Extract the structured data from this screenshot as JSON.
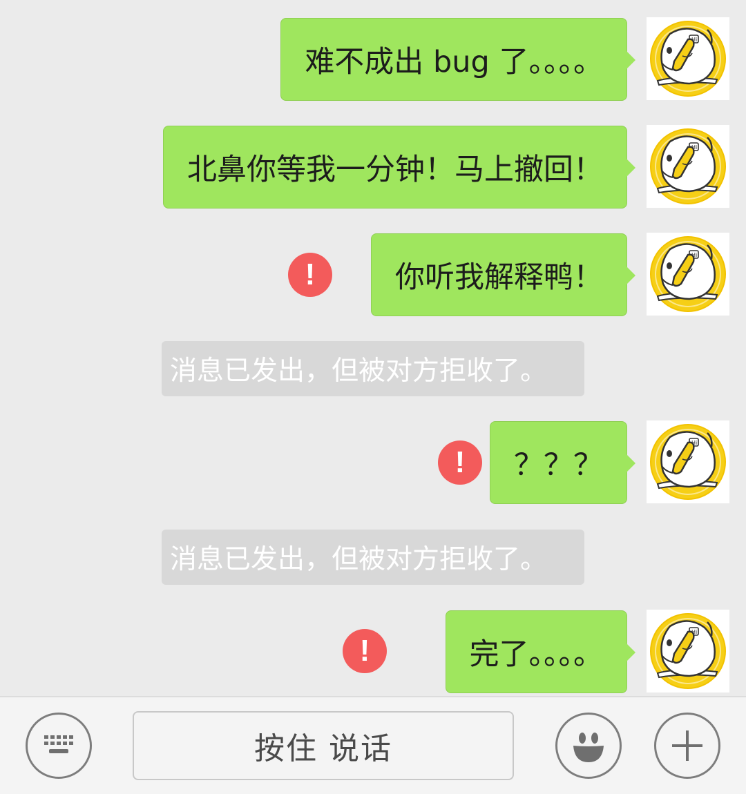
{
  "messages": [
    {
      "type": "sent",
      "text": "难不成出 bug 了。。。。",
      "failed": false
    },
    {
      "type": "sent",
      "text": "北鼻你等我一分钟！马上撤回！",
      "failed": false
    },
    {
      "type": "sent",
      "text": "你听我解释鸭！",
      "failed": true
    },
    {
      "type": "system",
      "text": "消息已发出，但被对方拒收了。"
    },
    {
      "type": "sent",
      "text": "？？？",
      "failed": true
    },
    {
      "type": "system",
      "text": "消息已发出，但被对方拒收了。"
    },
    {
      "type": "sent",
      "text": "完了。。。。",
      "failed": true
    }
  ],
  "error_mark": "!",
  "avatar": {
    "badge": "Hi"
  },
  "input_bar": {
    "keyboard_icon": "keyboard-icon",
    "voice_label": "按住 说话",
    "emoji_icon": "emoji-smile-icon",
    "plus_icon": "plus-icon"
  },
  "colors": {
    "background": "#ebebeb",
    "bubble": "#9fe65e",
    "error": "#f35b5b",
    "system_pill": "#d8d8d8"
  }
}
